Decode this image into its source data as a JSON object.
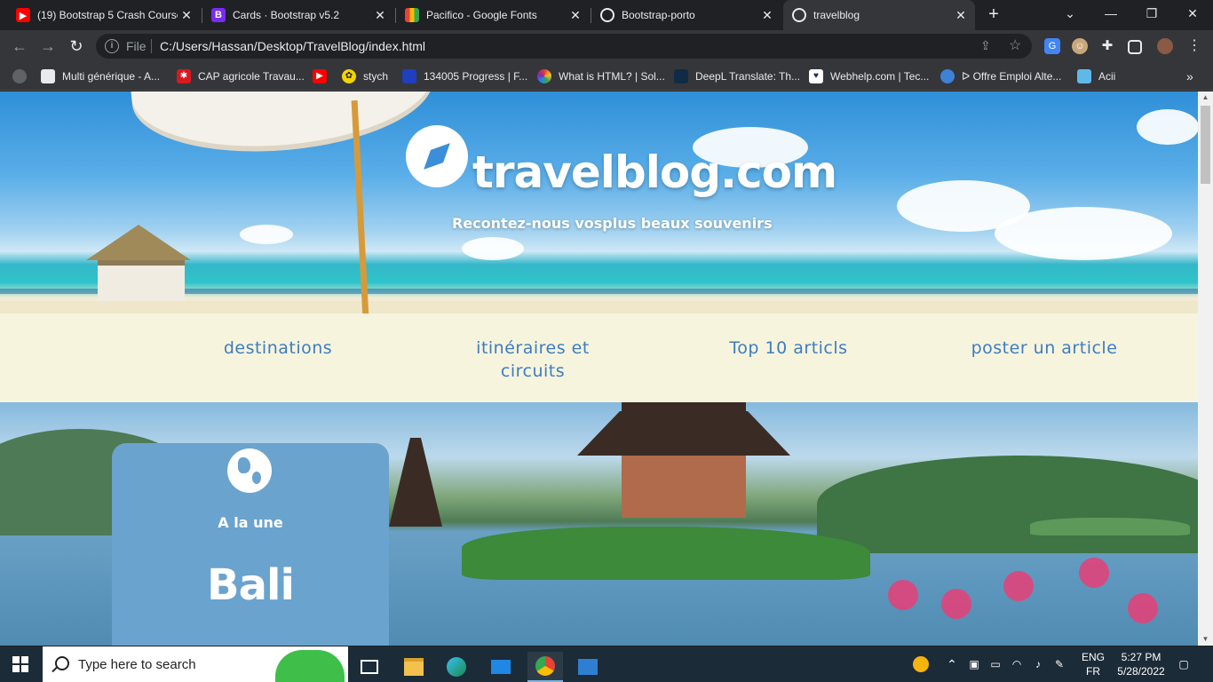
{
  "browser": {
    "tabs": [
      {
        "title": "(19) Bootstrap 5 Crash Course",
        "icon": "youtube-icon",
        "active": false
      },
      {
        "title": "Cards · Bootstrap v5.2",
        "icon": "bootstrap-icon",
        "active": false
      },
      {
        "title": "Pacifico - Google Fonts",
        "icon": "google-fonts-icon",
        "active": false
      },
      {
        "title": "Bootstrap-porto",
        "icon": "globe-icon",
        "active": false
      },
      {
        "title": "travelblog",
        "icon": "globe-icon",
        "active": true
      }
    ],
    "address": {
      "scheme": "File",
      "url": "C:/Users/Hassan/Desktop/TravelBlog/index.html"
    },
    "bookmarks": [
      {
        "label": "Multi générique - A...",
        "icon": "page-icon"
      },
      {
        "label": "CAP agricole Travau...",
        "icon": "cap-agricole-icon"
      },
      {
        "label": "",
        "icon": "youtube-icon"
      },
      {
        "label": "stych",
        "icon": "stych-icon"
      },
      {
        "label": "134005 Progress | F...",
        "icon": "progress-icon"
      },
      {
        "label": "What is HTML? | Sol...",
        "icon": "sololearn-icon"
      },
      {
        "label": "DeepL Translate: Th...",
        "icon": "deepl-icon"
      },
      {
        "label": "Webhelp.com | Tec...",
        "icon": "webhelp-icon"
      },
      {
        "label": "ᐅ Offre Emploi Alte...",
        "icon": "offre-icon"
      },
      {
        "label": "Acii",
        "icon": "acii-icon"
      }
    ]
  },
  "page": {
    "brand": "travelblog.com",
    "tagline": "Recontez-nous vosplus beaux souvenirs",
    "nav": [
      "destinations",
      "itinéraires et circuits",
      "Top 10 articls",
      "poster un article"
    ],
    "featured": {
      "kicker": "A la une",
      "place": "Bali"
    }
  },
  "taskbar": {
    "search_placeholder": "Type here to search",
    "lang_primary": "ENG",
    "lang_secondary": "FR",
    "time": "5:27 PM",
    "date": "5/28/2022"
  },
  "colors": {
    "accent_link": "#3d7dbf",
    "nav_bg": "#f7f4dd",
    "card_bg": "#6aa3ce",
    "chrome_dark": "#202124",
    "chrome_toolbar": "#35363a"
  }
}
